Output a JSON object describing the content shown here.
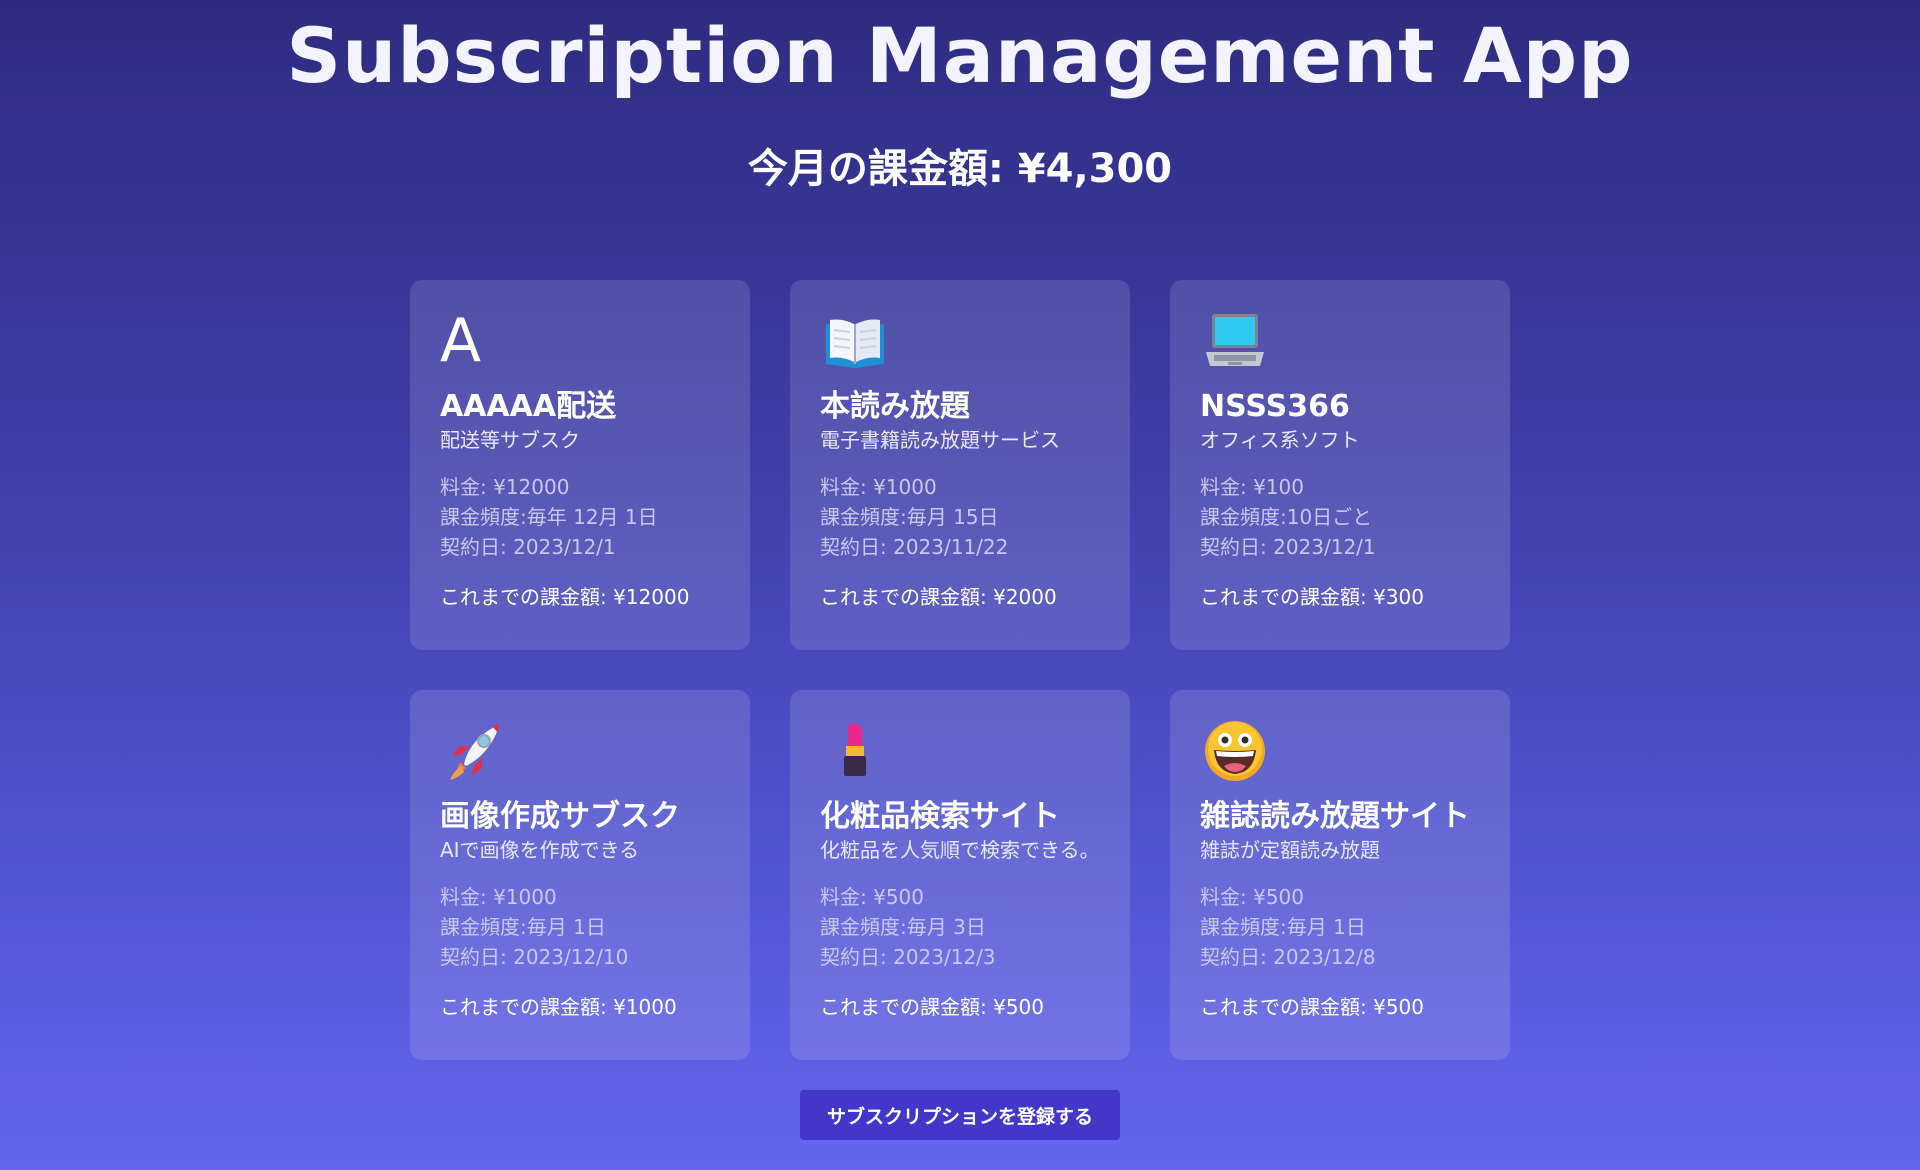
{
  "app": {
    "title": "Subscription Management App",
    "monthly_total": "今月の課金額: ¥4,300"
  },
  "cards": [
    {
      "icon": "letter-a-icon",
      "icon_text": "A",
      "name": "AAAAA配送",
      "description": "配送等サブスク",
      "price": "料金: ¥12000",
      "frequency": "課金頻度:毎年 12月 1日",
      "contract_date": "契約日: 2023/12/1",
      "total": "これまでの課金額: ¥12000"
    },
    {
      "icon": "open-book-icon",
      "name": "本読み放題",
      "description": "電子書籍読み放題サービス",
      "price": "料金: ¥1000",
      "frequency": "課金頻度:毎月 15日",
      "contract_date": "契約日: 2023/11/22",
      "total": "これまでの課金額: ¥2000"
    },
    {
      "icon": "laptop-icon",
      "name": "NSSS366",
      "description": "オフィス系ソフト",
      "price": "料金: ¥100",
      "frequency": "課金頻度:10日ごと",
      "contract_date": "契約日: 2023/12/1",
      "total": "これまでの課金額: ¥300"
    },
    {
      "icon": "rocket-icon",
      "name": "画像作成サブスク",
      "description": "AIで画像を作成できる",
      "price": "料金: ¥1000",
      "frequency": "課金頻度:毎月 1日",
      "contract_date": "契約日: 2023/12/10",
      "total": "これまでの課金額: ¥1000"
    },
    {
      "icon": "lipstick-icon",
      "name": "化粧品検索サイト",
      "description": "化粧品を人気順で検索できる。",
      "price": "料金: ¥500",
      "frequency": "課金頻度:毎月 3日",
      "contract_date": "契約日: 2023/12/3",
      "total": "これまでの課金額: ¥500"
    },
    {
      "icon": "grinning-face-icon",
      "name": "雑誌読み放題サイト",
      "description": "雑誌が定額読み放題",
      "price": "料金: ¥500",
      "frequency": "課金頻度:毎月 1日",
      "contract_date": "契約日: 2023/12/8",
      "total": "これまでの課金額: ¥500"
    }
  ],
  "register_button": {
    "label": "サブスクリプションを登録する"
  },
  "colors": {
    "background_top": "#2e2c80",
    "background_bottom": "#6465ef",
    "button": "#4337c9"
  }
}
